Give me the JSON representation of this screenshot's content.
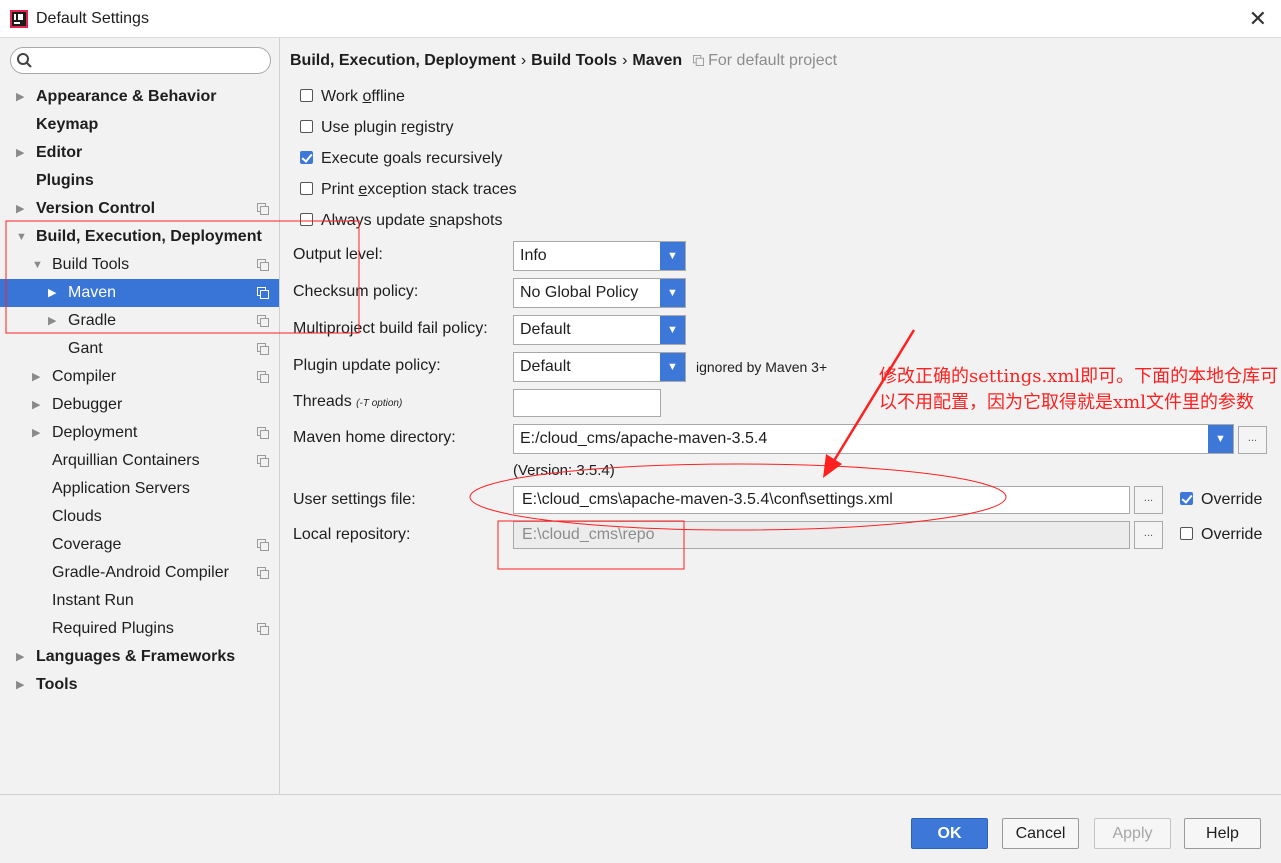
{
  "window": {
    "title": "Default Settings"
  },
  "search": {
    "placeholder": ""
  },
  "sidebar": {
    "items": [
      {
        "label": "Appearance & Behavior"
      },
      {
        "label": "Keymap"
      },
      {
        "label": "Editor"
      },
      {
        "label": "Plugins"
      },
      {
        "label": "Version Control"
      },
      {
        "label": "Build, Execution, Deployment"
      },
      {
        "label": "Build Tools"
      },
      {
        "label": "Maven"
      },
      {
        "label": "Gradle"
      },
      {
        "label": "Gant"
      },
      {
        "label": "Compiler"
      },
      {
        "label": "Debugger"
      },
      {
        "label": "Deployment"
      },
      {
        "label": "Arquillian Containers"
      },
      {
        "label": "Application Servers"
      },
      {
        "label": "Clouds"
      },
      {
        "label": "Coverage"
      },
      {
        "label": "Gradle-Android Compiler"
      },
      {
        "label": "Instant Run"
      },
      {
        "label": "Required Plugins"
      },
      {
        "label": "Languages & Frameworks"
      },
      {
        "label": "Tools"
      }
    ]
  },
  "breadcrumb": {
    "parts": [
      "Build, Execution, Deployment",
      "Build Tools",
      "Maven"
    ],
    "separator": "›",
    "project_note": "For default project"
  },
  "checkboxes": [
    {
      "label_pre": "Work ",
      "label_u": "o",
      "label_post": "ffline",
      "checked": false
    },
    {
      "label_pre": "Use plugin ",
      "label_u": "r",
      "label_post": "egistry",
      "checked": false
    },
    {
      "label_pre": "Execute ",
      "label_u": "g",
      "label_post": "oals recursively",
      "checked": true
    },
    {
      "label_pre": "Print ",
      "label_u": "e",
      "label_post": "xception stack traces",
      "checked": false
    },
    {
      "label_pre": "Always update ",
      "label_u": "s",
      "label_post": "napshots",
      "checked": false
    }
  ],
  "fields": {
    "output_level": {
      "label": "Output level:",
      "value": "Info"
    },
    "checksum_policy": {
      "label": "Checksum policy:",
      "value": "No Global Policy"
    },
    "multiproject_fail": {
      "label": "Multiproject build fail policy:",
      "value": "Default"
    },
    "plugin_update": {
      "label": "Plugin update policy:",
      "value": "Default",
      "note": "ignored by Maven 3+"
    },
    "threads": {
      "label": "Threads",
      "hint": "(-T option)",
      "value": ""
    },
    "maven_home": {
      "label": "Maven home directory:",
      "value": "E:/cloud_cms/apache-maven-3.5.4",
      "version": "(Version: 3.5.4)"
    },
    "user_settings": {
      "label": "User settings file:",
      "value": "E:\\cloud_cms\\apache-maven-3.5.4\\conf\\settings.xml",
      "override_label": "Override",
      "override": true
    },
    "local_repo": {
      "label": "Local repository:",
      "value": "E:\\cloud_cms\\repo",
      "override_label": "Override",
      "override": false
    },
    "browse_label": "..."
  },
  "annotation": {
    "text": "修改正确的settings.xml即可。下面的本地仓库可以不用配置，因为它取得就是xml文件里的参数",
    "color": "#ff2020"
  },
  "footer": {
    "ok": "OK",
    "cancel": "Cancel",
    "apply": "Apply",
    "help": "Help"
  },
  "colors": {
    "accent": "#3d78d8",
    "selection": "#3875d7",
    "annotation": "#ff2020"
  }
}
